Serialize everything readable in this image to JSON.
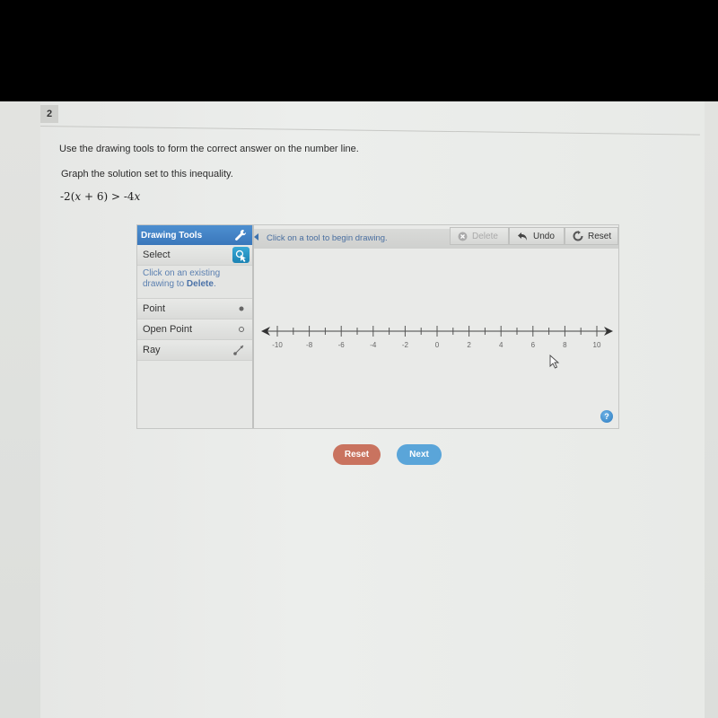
{
  "question": {
    "number": "2",
    "instruction": "Use the drawing tools to form the correct answer on the number line.",
    "prompt": "Graph the solution set to this inequality.",
    "inequality": {
      "left": "-2(",
      "var1": "x",
      "mid": " + 6) > -4",
      "var2": "x"
    }
  },
  "drawing_tools": {
    "header": "Drawing Tools",
    "header_icon": "wrench-icon",
    "select_label": "Select",
    "select_icon": "pointer-icon",
    "hint_line1": "Click on an existing",
    "hint_line2": "drawing to ",
    "hint_bold": "Delete",
    "hint_end": ".",
    "tools": [
      {
        "label": "Point",
        "icon": "filled-dot-icon"
      },
      {
        "label": "Open Point",
        "icon": "open-dot-icon"
      },
      {
        "label": "Ray",
        "icon": "ray-icon"
      }
    ]
  },
  "canvas": {
    "hint": "Click on a tool to begin drawing.",
    "delete_label": "Delete",
    "undo_label": "Undo",
    "reset_label": "Reset",
    "help_label": "?"
  },
  "number_line": {
    "min": -10,
    "max": 10,
    "minor_step": 1,
    "label_step": 2,
    "labels": [
      "-10",
      "-8",
      "-6",
      "-4",
      "-2",
      "0",
      "2",
      "4",
      "6",
      "8",
      "10"
    ]
  },
  "footer": {
    "reset_label": "Reset",
    "next_label": "Next"
  },
  "colors": {
    "header_blue": "#3a77bb",
    "select_teal": "#1b83b4",
    "reset_red": "#c9735f",
    "next_blue": "#5aa5d9",
    "hint_blue": "#4a6fa0"
  }
}
